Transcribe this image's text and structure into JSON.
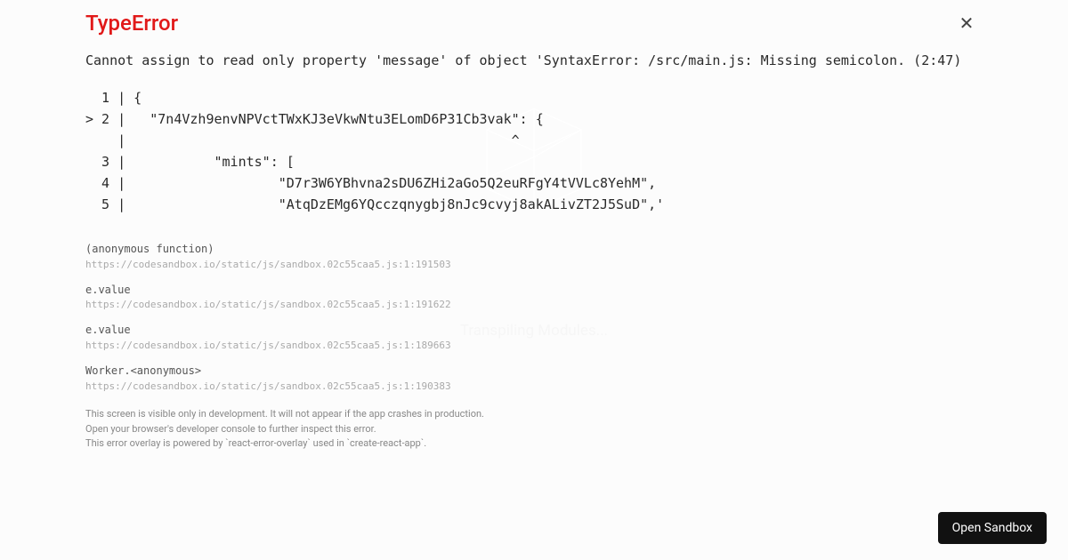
{
  "background": {
    "status_text": "Transpiling Modules..."
  },
  "error": {
    "title": "TypeError",
    "message": "Cannot assign to read only property 'message' of object 'SyntaxError: /src/main.js: Missing semicolon. (2:47)",
    "code": "  1 | {\n> 2 |   \"7n4Vzh9envNPVctTWxKJ3eVkwNtu3ELomD6P31Cb3vak\": {\n    |                                                ^\n  3 |           \"mints\": [\n  4 |                   \"D7r3W6YBhvna2sDU6ZHi2aGo5Q2euRFgY4tVVLc8YehM\",\n  5 |                   \"AtqDzEMg6YQcczqnygbj8nJc9cvyj8akALivZT2J5SuD\",'"
  },
  "stack": [
    {
      "call": "(anonymous function)",
      "source": "https://codesandbox.io/static/js/sandbox.02c55caa5.js:1:191503"
    },
    {
      "call": "e.value",
      "source": "https://codesandbox.io/static/js/sandbox.02c55caa5.js:1:191622"
    },
    {
      "call": "e.value",
      "source": "https://codesandbox.io/static/js/sandbox.02c55caa5.js:1:189663"
    },
    {
      "call": "Worker.<anonymous>",
      "source": "https://codesandbox.io/static/js/sandbox.02c55caa5.js:1:190383"
    }
  ],
  "footer": {
    "line1": "This screen is visible only in development. It will not appear if the app crashes in production.",
    "line2": "Open your browser's developer console to further inspect this error.",
    "line3": "This error overlay is powered by `react-error-overlay` used in `create-react-app`."
  },
  "button": {
    "open_sandbox": "Open Sandbox"
  }
}
